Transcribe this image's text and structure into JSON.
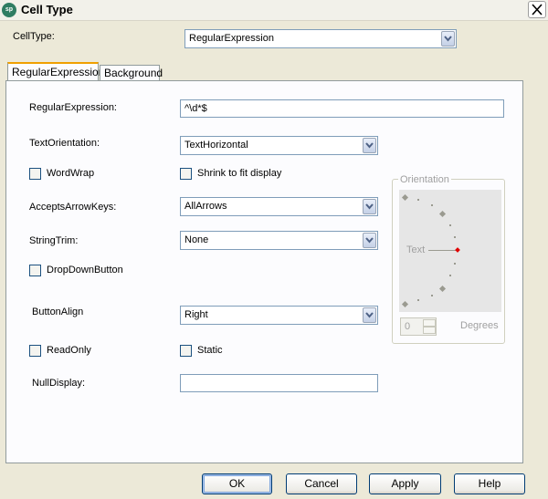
{
  "window": {
    "title": "Cell Type",
    "app_icon_text": "sp"
  },
  "celltype": {
    "label": "CellType:",
    "value": "RegularExpression"
  },
  "tabs": [
    {
      "label": "RegularExpression",
      "active": true
    },
    {
      "label": "Background",
      "active": false
    }
  ],
  "form": {
    "regex": {
      "label": "RegularExpression:",
      "value": "^\\d*$"
    },
    "text_orientation": {
      "label": "TextOrientation:",
      "value": "TextHorizontal"
    },
    "wordwrap": {
      "label": "WordWrap",
      "checked": false
    },
    "shrink": {
      "label": "Shrink to fit display",
      "checked": false
    },
    "accepts_arrow_keys": {
      "label": "AcceptsArrowKeys:",
      "value": "AllArrows"
    },
    "string_trim": {
      "label": "StringTrim:",
      "value": "None"
    },
    "dropdown_button": {
      "label": "DropDownButton",
      "checked": false
    },
    "button_align": {
      "label": "ButtonAlign",
      "value": "Right"
    },
    "readonly": {
      "label": "ReadOnly",
      "checked": false
    },
    "static": {
      "label": "Static",
      "checked": false
    },
    "null_display": {
      "label": "NullDisplay:",
      "value": ""
    }
  },
  "orientation": {
    "title": "Orientation",
    "sample_text": "Text",
    "degrees_value": "0",
    "degrees_label": "Degrees",
    "selected_color": "#e00000"
  },
  "buttons": {
    "ok": "OK",
    "cancel": "Cancel",
    "apply": "Apply",
    "help": "Help"
  }
}
